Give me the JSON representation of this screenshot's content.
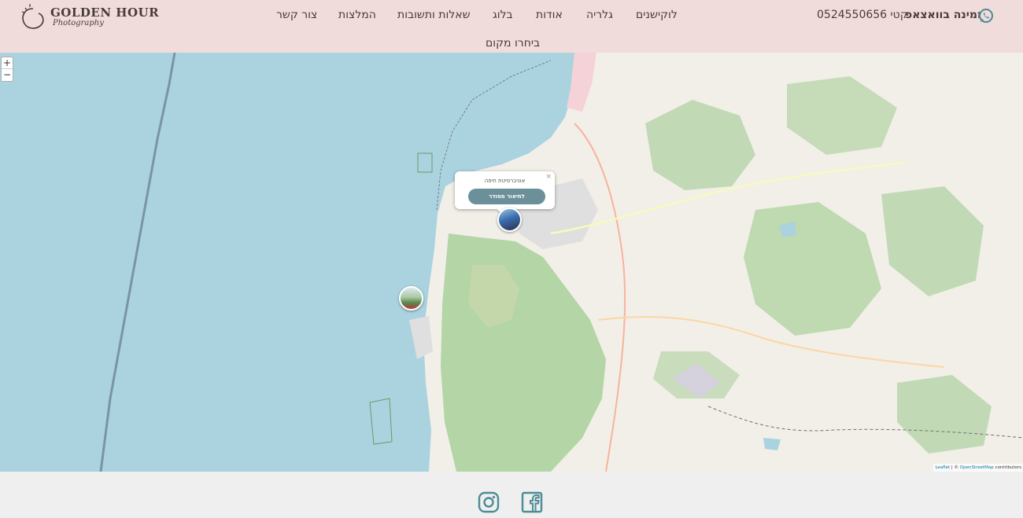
{
  "brand": {
    "name": "GOLDEN HOUR",
    "tagline": "Photography"
  },
  "nav": {
    "items": [
      {
        "label": "לוקישנים"
      },
      {
        "label": "גלריה"
      },
      {
        "label": "אודות"
      },
      {
        "label": "בלוג"
      },
      {
        "label": "שאלות ותשובות"
      },
      {
        "label": "המלצות"
      },
      {
        "label": "צור קשר"
      }
    ],
    "second_row": "ביחרו מקום"
  },
  "contact": {
    "phone": "קטי 0524550656",
    "whatsapp_label": "זמינה בוואצאפ",
    "whatsapp_icon": "whatsapp-icon"
  },
  "map": {
    "zoom_in": "+",
    "zoom_out": "−",
    "popup": {
      "title": "אוניברסיטת חיפה",
      "close": "×",
      "button": "לתיאור מסודר"
    },
    "attribution": {
      "leaflet": "Leaflet",
      "separator": " | © ",
      "osm": "OpenStreetMap",
      "contrib": " contributors"
    },
    "colors": {
      "sea": "#aad3df",
      "land": "#f2efe9",
      "forest": "#add19e",
      "popup_button": "#6b9099"
    }
  },
  "footer": {
    "icons": [
      "instagram-icon",
      "facebook-icon"
    ],
    "icon_color": "#4d8b96"
  }
}
